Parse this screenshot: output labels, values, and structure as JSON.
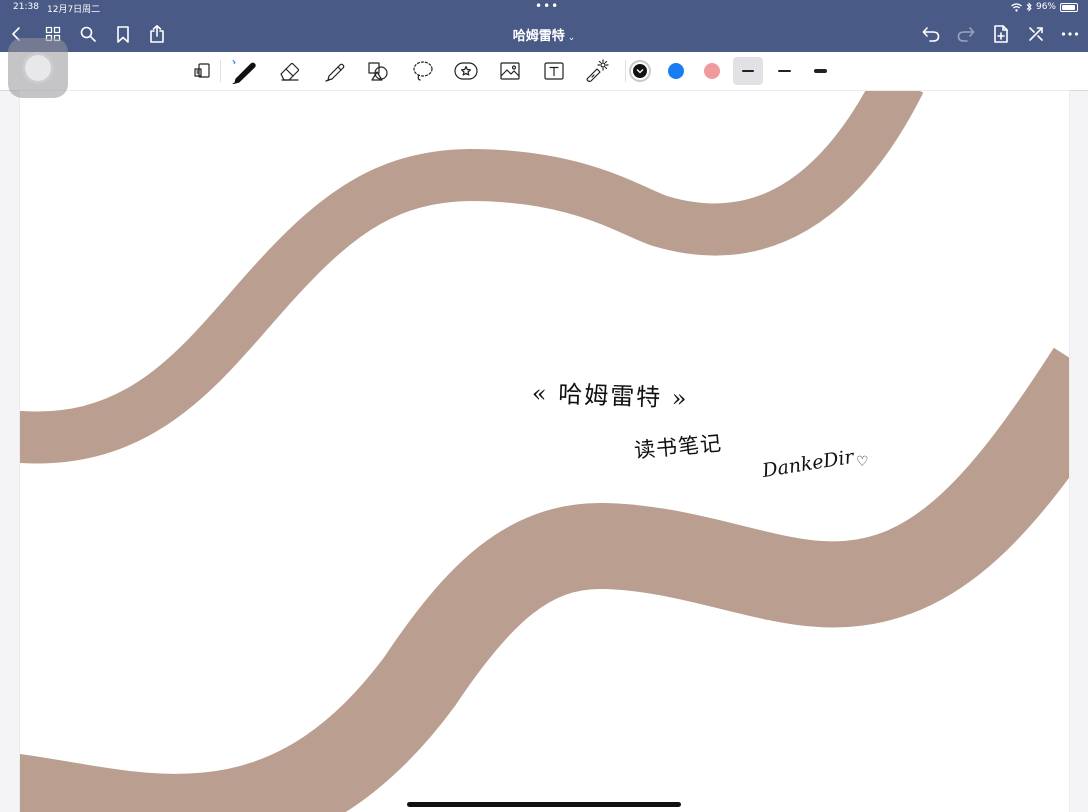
{
  "status_bar": {
    "time": "21:38",
    "date": "12月7日周二",
    "battery": "96%",
    "battery_level": 0.96
  },
  "nav": {
    "title": "哈姆雷特",
    "title_chevron": "⌄",
    "icons": [
      "back-icon",
      "grid-icon",
      "search-icon",
      "bookmark-icon",
      "share-icon",
      "undo-icon",
      "redo-icon",
      "add-page-icon",
      "close-expand-icon",
      "more-icon"
    ]
  },
  "toolbar": {
    "tools": [
      "hand-read-icon",
      "pen-icon",
      "eraser-icon",
      "highlighter-icon",
      "shapes-icon",
      "lasso-icon",
      "elements-icon",
      "image-icon",
      "text-icon",
      "laser-pointer-icon"
    ],
    "colors": [
      "#111111",
      "#1a7cf2",
      "#f09a9e"
    ],
    "selected_color": "#111111",
    "selected_size": "thin"
  },
  "page": {
    "band_color": "#ba9e8f",
    "handwriting": {
      "title": "« 哈姆雷特 »",
      "subtitle": "读书笔记",
      "signature": "DankeDir",
      "heart": "♡"
    }
  }
}
